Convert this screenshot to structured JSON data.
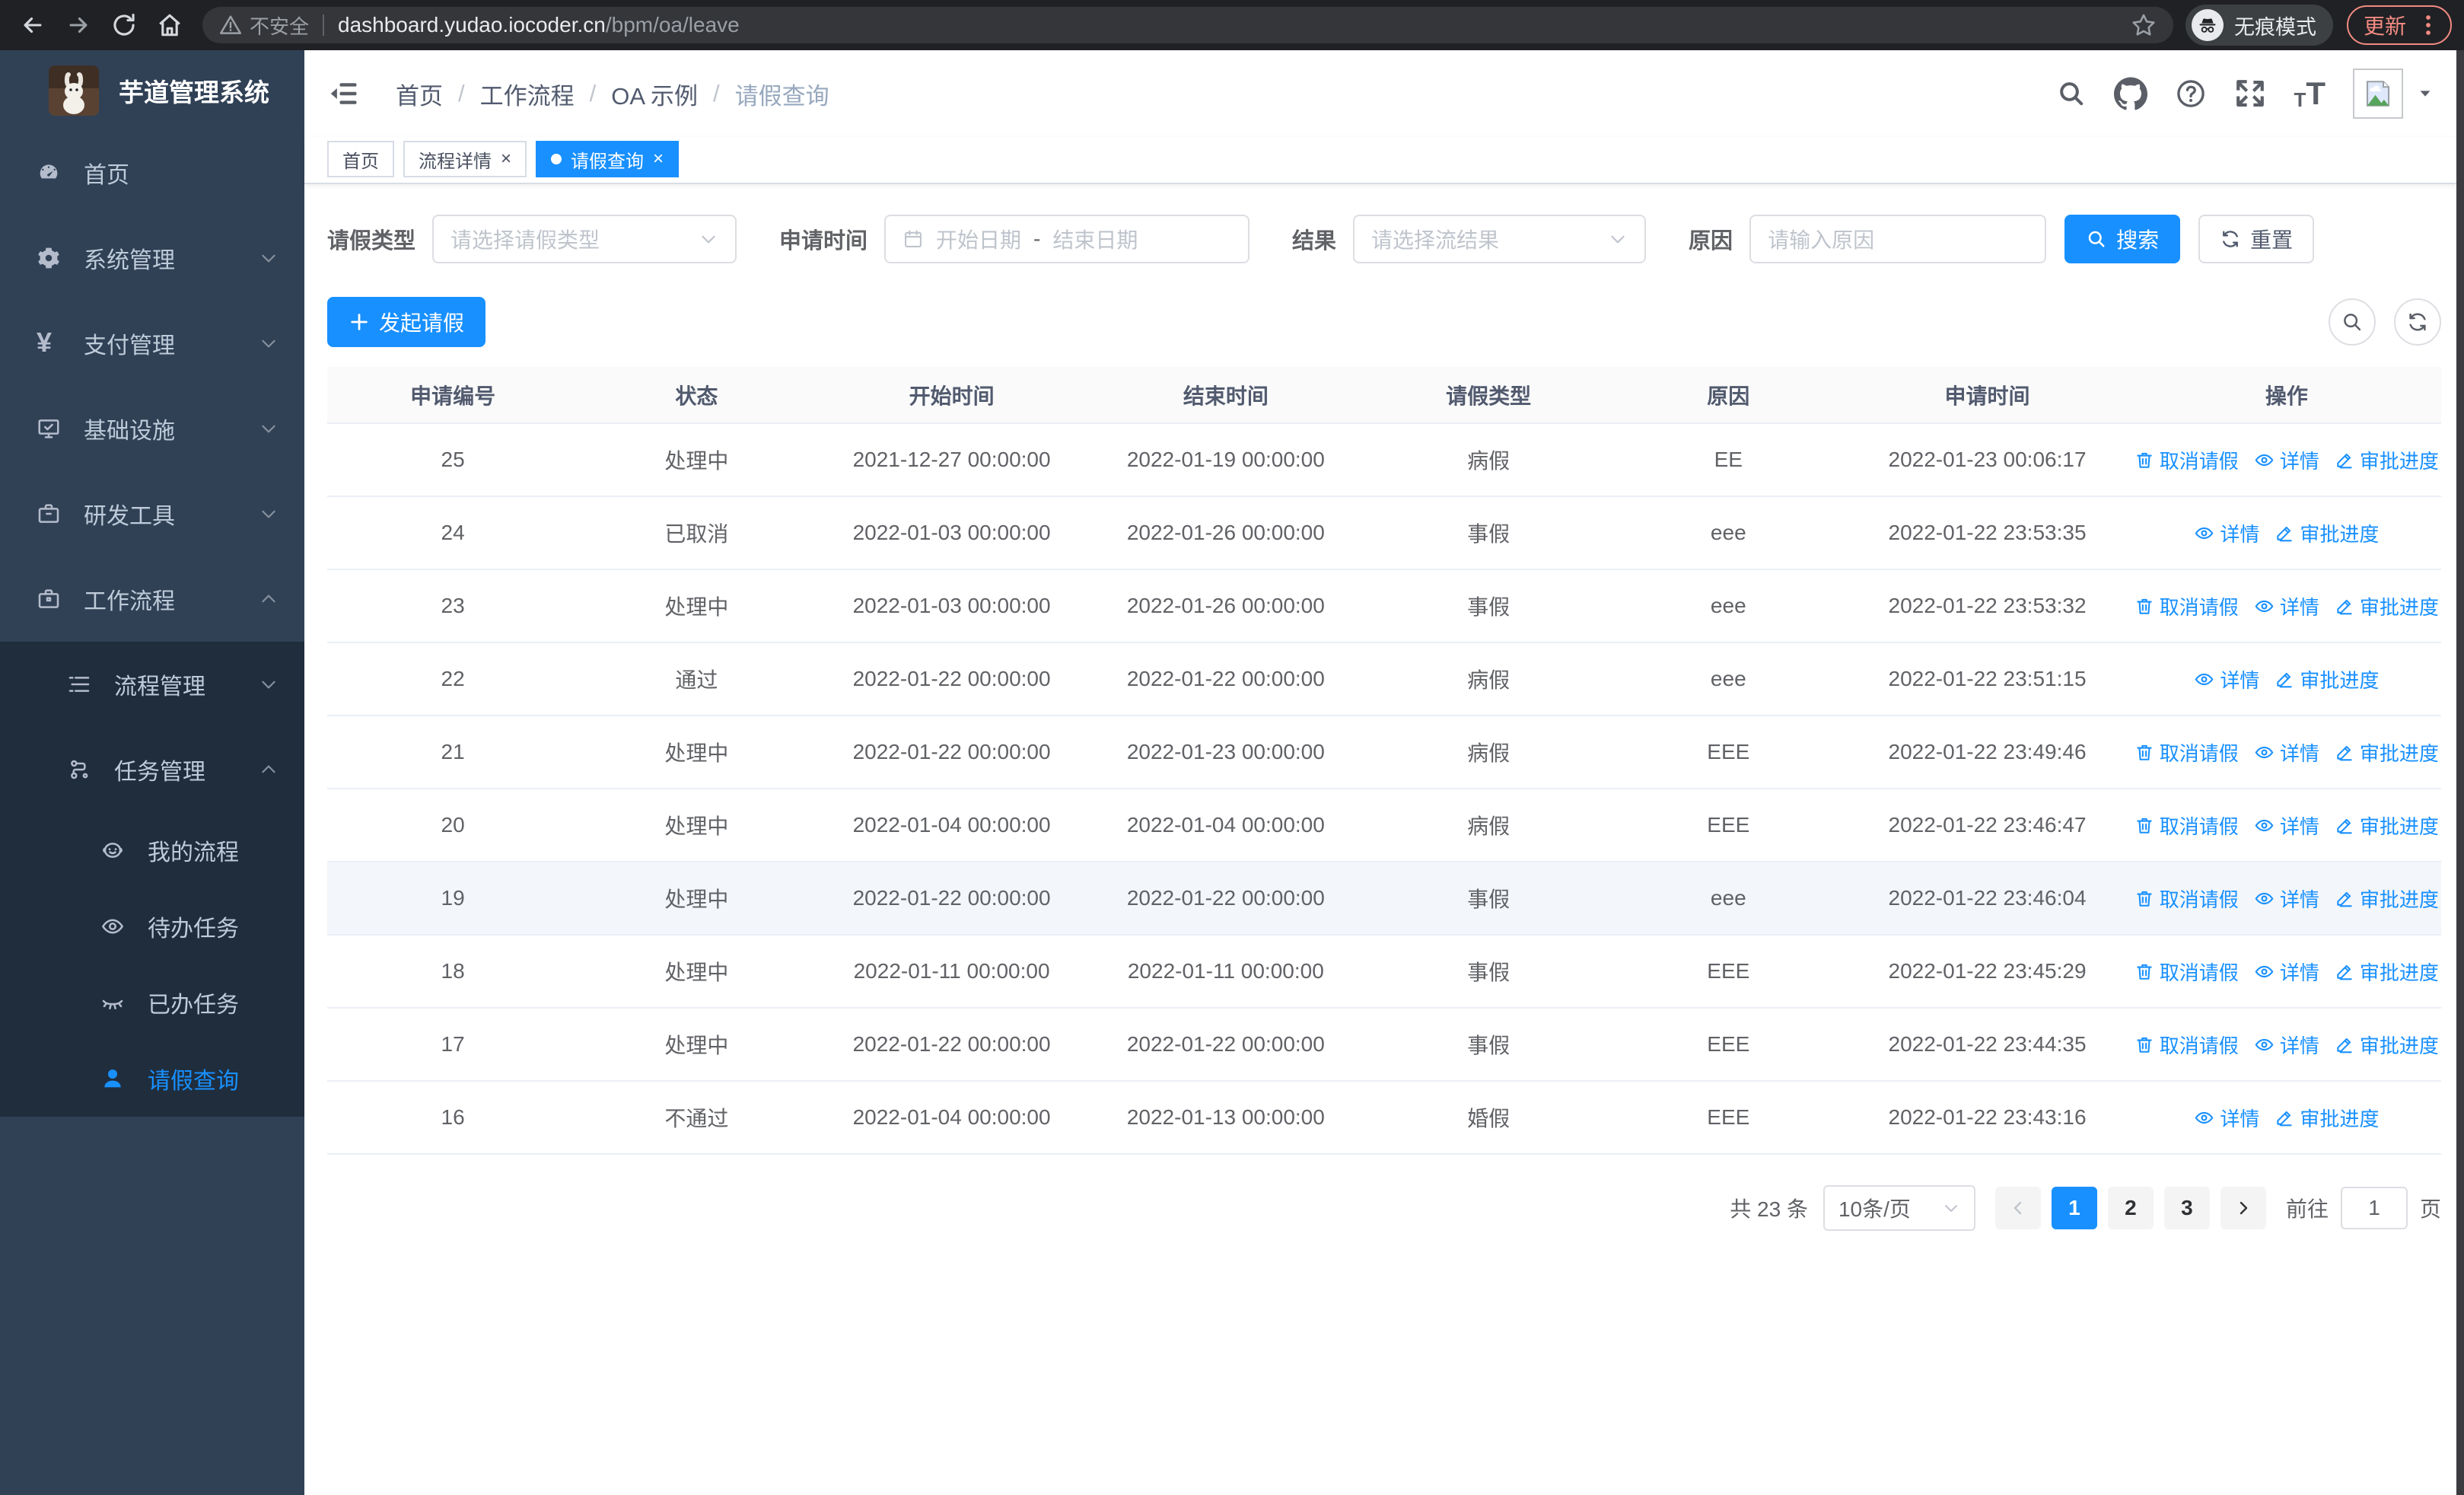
{
  "browser": {
    "security_label": "不安全",
    "url_host": "dashboard.yudao.iocoder.cn",
    "url_path": "/bpm/oa/leave",
    "incognito_label": "无痕模式",
    "update_label": "更新"
  },
  "sidebar": {
    "title": "芋道管理系统",
    "menu": [
      {
        "name": "home",
        "icon": "dashboard-icon",
        "label": "首页",
        "level": 1
      },
      {
        "name": "system-management",
        "icon": "gear-icon",
        "label": "系统管理",
        "level": 1,
        "chevron": "down"
      },
      {
        "name": "payment-management",
        "icon": "yen-icon",
        "label": "支付管理",
        "level": 1,
        "chevron": "down"
      },
      {
        "name": "infrastructure",
        "icon": "monitor-icon",
        "label": "基础设施",
        "level": 1,
        "chevron": "down"
      },
      {
        "name": "dev-tools",
        "icon": "briefcase-icon",
        "label": "研发工具",
        "level": 1,
        "chevron": "down"
      },
      {
        "name": "workflow",
        "icon": "suitcase-icon",
        "label": "工作流程",
        "level": 1,
        "chevron": "up"
      },
      {
        "name": "process-management",
        "icon": "list-tree-icon",
        "label": "流程管理",
        "level": 2,
        "chevron": "down",
        "group": true
      },
      {
        "name": "task-management",
        "icon": "flow-icon",
        "label": "任务管理",
        "level": 2,
        "chevron": "up",
        "group": true
      },
      {
        "name": "my-processes",
        "icon": "robot-face-icon",
        "label": "我的流程",
        "level": 3,
        "group": true
      },
      {
        "name": "todo-tasks",
        "icon": "eye-open-icon",
        "label": "待办任务",
        "level": 3,
        "group": true
      },
      {
        "name": "done-tasks",
        "icon": "eye-closed-icon",
        "label": "已办任务",
        "level": 3,
        "group": true
      },
      {
        "name": "leave-query",
        "icon": "user-icon",
        "label": "请假查询",
        "level": 3,
        "group": true,
        "active": true
      }
    ]
  },
  "header": {
    "breadcrumb": [
      "首页",
      "工作流程",
      "OA 示例",
      "请假查询"
    ]
  },
  "tabs": [
    {
      "name": "home",
      "label": "首页"
    },
    {
      "name": "process-detail",
      "label": "流程详情",
      "closable": true
    },
    {
      "name": "leave-query",
      "label": "请假查询",
      "closable": true,
      "active": true
    }
  ],
  "filters": {
    "leave_type_label": "请假类型",
    "leave_type_placeholder": "请选择请假类型",
    "apply_time_label": "申请时间",
    "date_start_placeholder": "开始日期",
    "date_separator": "-",
    "date_end_placeholder": "结束日期",
    "result_label": "结果",
    "result_placeholder": "请选择流结果",
    "reason_label": "原因",
    "reason_placeholder": "请输入原因",
    "search_label": "搜索",
    "reset_label": "重置"
  },
  "toolbar": {
    "create_label": "发起请假"
  },
  "table": {
    "columns": [
      "申请编号",
      "状态",
      "开始时间",
      "结束时间",
      "请假类型",
      "原因",
      "申请时间",
      "操作"
    ],
    "action_labels": {
      "cancel": "取消请假",
      "detail": "详情",
      "progress": "审批进度"
    },
    "rows": [
      {
        "id": "25",
        "status": "处理中",
        "start": "2021-12-27 00:00:00",
        "end": "2022-01-19 00:00:00",
        "type": "病假",
        "reason": "EE",
        "applied": "2022-01-23 00:06:17",
        "actions": [
          "cancel",
          "detail",
          "progress"
        ]
      },
      {
        "id": "24",
        "status": "已取消",
        "start": "2022-01-03 00:00:00",
        "end": "2022-01-26 00:00:00",
        "type": "事假",
        "reason": "eee",
        "applied": "2022-01-22 23:53:35",
        "actions": [
          "detail",
          "progress"
        ]
      },
      {
        "id": "23",
        "status": "处理中",
        "start": "2022-01-03 00:00:00",
        "end": "2022-01-26 00:00:00",
        "type": "事假",
        "reason": "eee",
        "applied": "2022-01-22 23:53:32",
        "actions": [
          "cancel",
          "detail",
          "progress"
        ]
      },
      {
        "id": "22",
        "status": "通过",
        "start": "2022-01-22 00:00:00",
        "end": "2022-01-22 00:00:00",
        "type": "病假",
        "reason": "eee",
        "applied": "2022-01-22 23:51:15",
        "actions": [
          "detail",
          "progress"
        ]
      },
      {
        "id": "21",
        "status": "处理中",
        "start": "2022-01-22 00:00:00",
        "end": "2022-01-23 00:00:00",
        "type": "病假",
        "reason": "EEE",
        "applied": "2022-01-22 23:49:46",
        "actions": [
          "cancel",
          "detail",
          "progress"
        ]
      },
      {
        "id": "20",
        "status": "处理中",
        "start": "2022-01-04 00:00:00",
        "end": "2022-01-04 00:00:00",
        "type": "病假",
        "reason": "EEE",
        "applied": "2022-01-22 23:46:47",
        "actions": [
          "cancel",
          "detail",
          "progress"
        ]
      },
      {
        "id": "19",
        "status": "处理中",
        "start": "2022-01-22 00:00:00",
        "end": "2022-01-22 00:00:00",
        "type": "事假",
        "reason": "eee",
        "applied": "2022-01-22 23:46:04",
        "actions": [
          "cancel",
          "detail",
          "progress"
        ],
        "highlight": true
      },
      {
        "id": "18",
        "status": "处理中",
        "start": "2022-01-11 00:00:00",
        "end": "2022-01-11 00:00:00",
        "type": "事假",
        "reason": "EEE",
        "applied": "2022-01-22 23:45:29",
        "actions": [
          "cancel",
          "detail",
          "progress"
        ]
      },
      {
        "id": "17",
        "status": "处理中",
        "start": "2022-01-22 00:00:00",
        "end": "2022-01-22 00:00:00",
        "type": "事假",
        "reason": "EEE",
        "applied": "2022-01-22 23:44:35",
        "actions": [
          "cancel",
          "detail",
          "progress"
        ]
      },
      {
        "id": "16",
        "status": "不通过",
        "start": "2022-01-04 00:00:00",
        "end": "2022-01-13 00:00:00",
        "type": "婚假",
        "reason": "EEE",
        "applied": "2022-01-22 23:43:16",
        "actions": [
          "detail",
          "progress"
        ]
      }
    ]
  },
  "pagination": {
    "total": "共 23 条",
    "page_size": "10条/页",
    "pages": [
      "1",
      "2",
      "3"
    ],
    "active_page": "1",
    "goto_label": "前往",
    "goto_value": "1",
    "page_unit": "页"
  },
  "colors": {
    "primary": "#1890ff",
    "sidebar_bg": "#304156",
    "submenu_bg": "#1f2d3d",
    "update_accent": "#f28b82"
  }
}
